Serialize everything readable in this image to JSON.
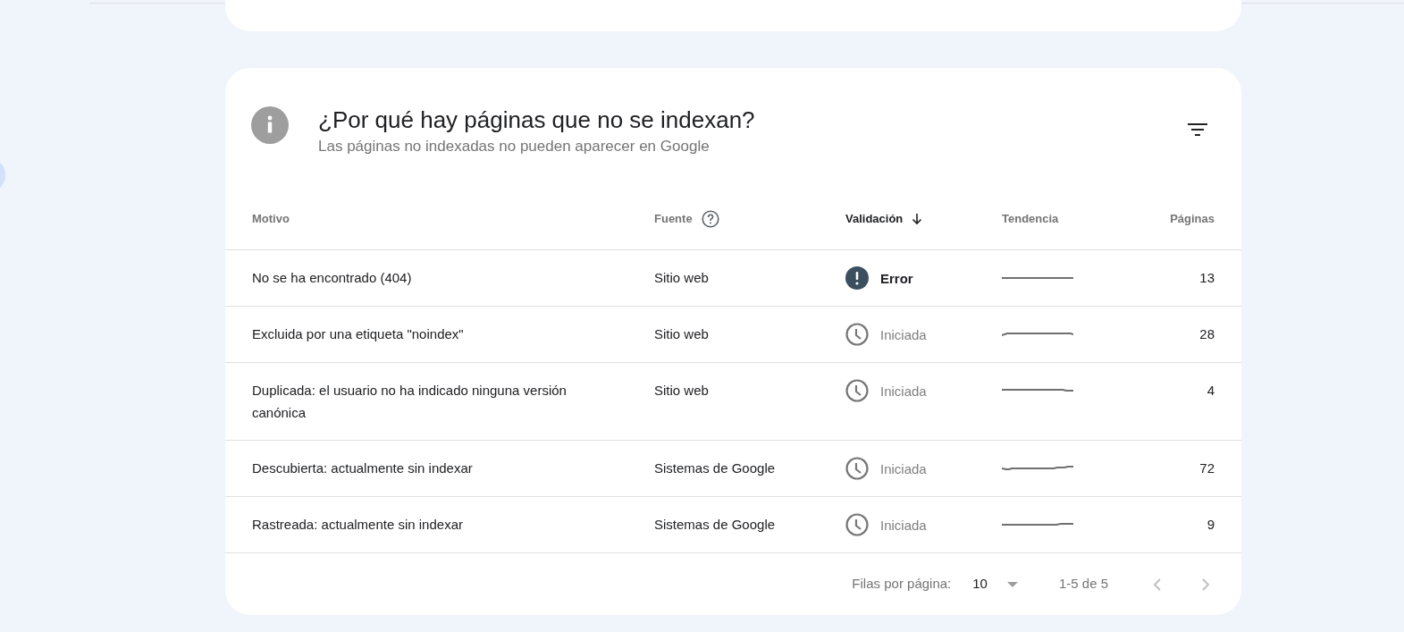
{
  "card": {
    "title": "¿Por qué hay páginas que no se indexan?",
    "subtitle": "Las páginas no indexadas no pueden aparecer en Google"
  },
  "table": {
    "columns": [
      {
        "label": "Motivo",
        "sorted": false
      },
      {
        "label": "Fuente",
        "sorted": false,
        "help": true
      },
      {
        "label": "Validación",
        "sorted": true
      },
      {
        "label": "Tendencia",
        "sorted": false
      },
      {
        "label": "Páginas",
        "sorted": false
      }
    ],
    "rows": [
      {
        "reason": "No se ha encontrado (404)",
        "source": "Sitio web",
        "validation": {
          "kind": "error",
          "label": "Error"
        },
        "pages": "13"
      },
      {
        "reason": "Excluida por una etiqueta \"noindex\"",
        "source": "Sitio web",
        "validation": {
          "kind": "started",
          "label": "Iniciada"
        },
        "pages": "28"
      },
      {
        "reason": "Duplicada: el usuario no ha indicado ninguna versión canónica",
        "source": "Sitio web",
        "validation": {
          "kind": "started",
          "label": "Iniciada"
        },
        "pages": "4"
      },
      {
        "reason": "Descubierta: actualmente sin indexar",
        "source": "Sistemas de Google",
        "validation": {
          "kind": "started",
          "label": "Iniciada"
        },
        "pages": "72"
      },
      {
        "reason": "Rastreada: actualmente sin indexar",
        "source": "Sistemas de Google",
        "validation": {
          "kind": "started",
          "label": "Iniciada"
        },
        "pages": "9"
      }
    ]
  },
  "pagination": {
    "rows_label": "Filas por página:",
    "rows_value": "10",
    "range": "1-5 de 5",
    "prev_disabled": true,
    "next_disabled": true
  }
}
